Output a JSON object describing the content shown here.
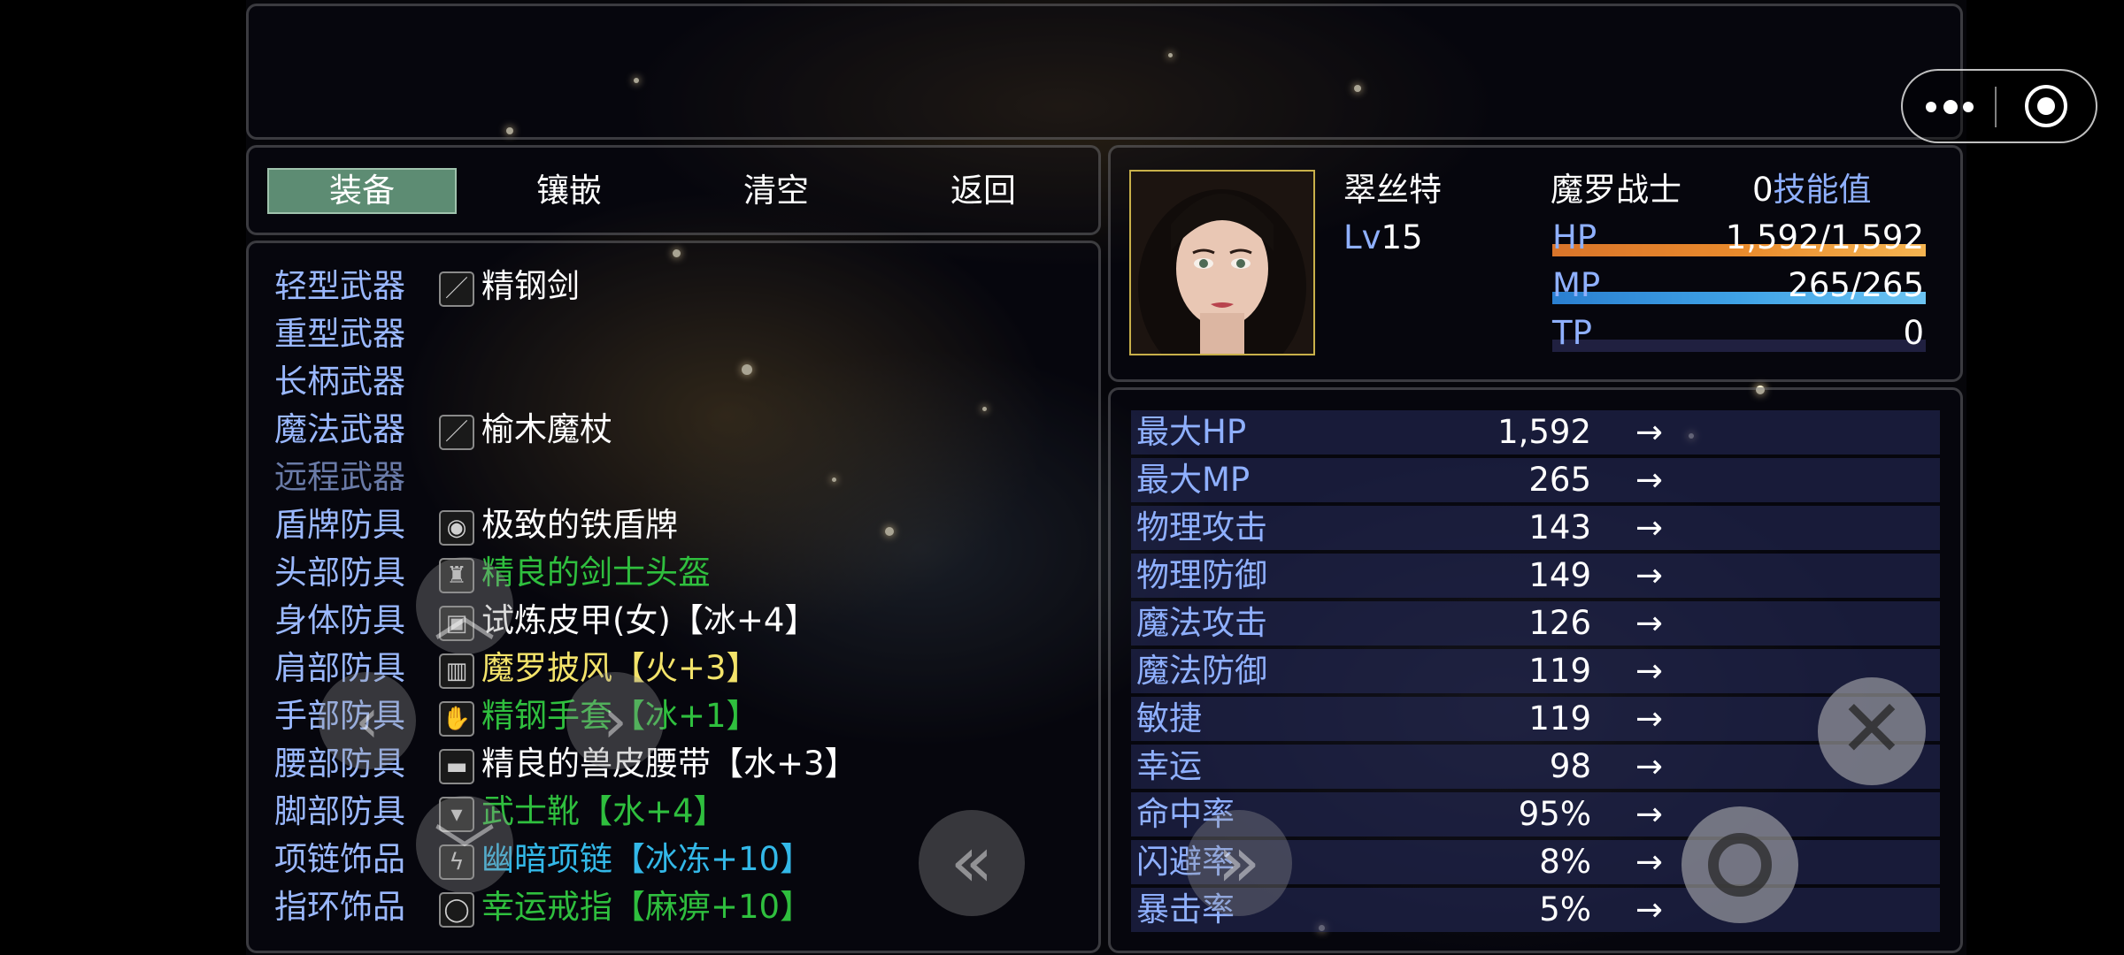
{
  "window_controls": {
    "more_icon": "more-dots-icon",
    "capture_icon": "record-target-icon"
  },
  "commands": [
    {
      "label": "装备",
      "active": true
    },
    {
      "label": "镶嵌",
      "active": false
    },
    {
      "label": "清空",
      "active": false
    },
    {
      "label": "返回",
      "active": false
    }
  ],
  "slots": [
    {
      "label": "轻型武器",
      "icon": "sword-icon",
      "item": "精钢剑",
      "color": "#ffffff"
    },
    {
      "label": "重型武器",
      "icon": "",
      "item": "",
      "color": "#ffffff"
    },
    {
      "label": "长柄武器",
      "icon": "",
      "item": "",
      "color": "#ffffff"
    },
    {
      "label": "魔法武器",
      "icon": "staff-icon",
      "item": "榆木魔杖",
      "color": "#ffffff"
    },
    {
      "label": "远程武器",
      "icon": "",
      "item": "",
      "color": "#ffffff"
    },
    {
      "label": "盾牌防具",
      "icon": "shield-icon",
      "item": "极致的铁盾牌",
      "color": "#ffffff"
    },
    {
      "label": "头部防具",
      "icon": "helmet-icon",
      "item": "精良的剑士头盔",
      "color": "#2fbf3e"
    },
    {
      "label": "身体防具",
      "icon": "armor-icon",
      "item": "试炼皮甲(女)【冰+4】",
      "color": "#ffffff"
    },
    {
      "label": "肩部防具",
      "icon": "cloak-icon",
      "item": "魔罗披风【火+3】",
      "color": "#f3e36a"
    },
    {
      "label": "手部防具",
      "icon": "gauntlet-icon",
      "item": "精钢手套【冰+1】",
      "color": "#2fbf3e"
    },
    {
      "label": "腰部防具",
      "icon": "belt-icon",
      "item": "精良的兽皮腰带【水+3】",
      "color": "#ffffff"
    },
    {
      "label": "脚部防具",
      "icon": "boots-icon",
      "item": "武士靴【水+4】",
      "color": "#2fbf3e"
    },
    {
      "label": "项链饰品",
      "icon": "necklace-icon",
      "item": "幽暗项链【冰冻+10】",
      "color": "#33b8e8"
    },
    {
      "label": "指环饰品",
      "icon": "ring-icon",
      "item": "幸运戒指【麻痹+10】",
      "color": "#2fbf3e"
    }
  ],
  "actor": {
    "name": "翠丝特",
    "class": "魔罗战士",
    "skill_points": "0",
    "skill_points_label": "技能值",
    "level_label": "Lv",
    "level": "15",
    "hp_label": "HP",
    "hp_text": "1,592/1,592",
    "hp_ratio": 1.0,
    "mp_label": "MP",
    "mp_text": "265/265",
    "mp_ratio": 1.0,
    "tp_label": "TP",
    "tp_text": "0",
    "tp_ratio": 0.0
  },
  "colors": {
    "hp_gauge": "#e98a2c",
    "mp_gauge": "#3fa2e6",
    "active_tab": "#5d8c73",
    "system_label": "#8fb0ff"
  },
  "stats": [
    {
      "name": "最大HP",
      "value": "1,592"
    },
    {
      "name": "最大MP",
      "value": "265"
    },
    {
      "name": "物理攻击",
      "value": "143"
    },
    {
      "name": "物理防御",
      "value": "149"
    },
    {
      "name": "魔法攻击",
      "value": "126"
    },
    {
      "name": "魔法防御",
      "value": "119"
    },
    {
      "name": "敏捷",
      "value": "119"
    },
    {
      "name": "幸运",
      "value": "98"
    },
    {
      "name": "命中率",
      "value": "95%"
    },
    {
      "name": "闪避率",
      "value": "8%"
    },
    {
      "name": "暴击率",
      "value": "5%"
    }
  ],
  "stat_arrow": "→",
  "touch_controls": [
    "up-chevron-icon",
    "left-chevron-icon",
    "right-chevron-icon",
    "down-chevron-icon",
    "double-left-icon",
    "close-icon",
    "confirm-circle-icon"
  ]
}
